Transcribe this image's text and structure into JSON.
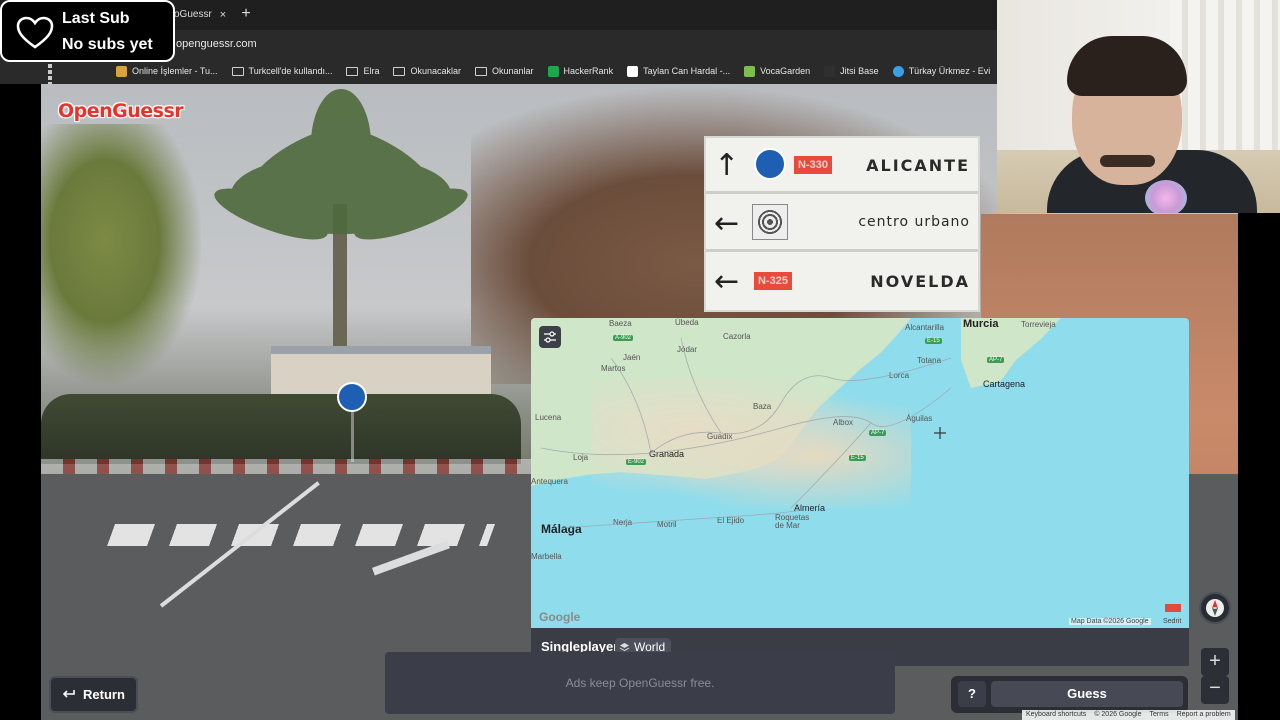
{
  "browser": {
    "tab_title": "oGuessr",
    "tab_close": "×",
    "new_tab": "+",
    "url": "openguessr.com",
    "bookmarks": [
      {
        "label": "Online İşlemler - Tu...",
        "type": "site",
        "color": "#d9a33c"
      },
      {
        "label": "Turkcell'de kullandı...",
        "type": "folder"
      },
      {
        "label": "Elra",
        "type": "folder"
      },
      {
        "label": "Okunacaklar",
        "type": "folder"
      },
      {
        "label": "Okunanlar",
        "type": "folder"
      },
      {
        "label": "HackerRank",
        "type": "site",
        "color": "#1ba94c"
      },
      {
        "label": "Taylan Can Hardal -...",
        "type": "site",
        "color": "#ffffff"
      },
      {
        "label": "VocaGarden",
        "type": "site",
        "color": "#7cc04b"
      },
      {
        "label": "Jitsi Base",
        "type": "site",
        "color": "#2f2f2f"
      },
      {
        "label": "Türkay Ürkmez - Evi",
        "type": "site",
        "color": "#3aa0e6"
      }
    ]
  },
  "sub_badge": {
    "line1": "Last Sub",
    "line2": "No subs yet"
  },
  "game": {
    "logo": "OpenGuessr",
    "road_sign": {
      "rows": [
        {
          "arrow": "↑",
          "plate": "N-330",
          "destination": "ALICANTE"
        },
        {
          "arrow": "←",
          "plate": "",
          "destination": "centro urbano"
        },
        {
          "arrow": "←",
          "plate": "N-325",
          "destination": "NOVELDA"
        }
      ]
    },
    "map": {
      "places": [
        "Baeza",
        "Úbeda",
        "Cazorla",
        "Alcantarilla",
        "Murcia",
        "Torrevieja",
        "Jaén",
        "Jódar",
        "Martos",
        "Lorca",
        "Totana",
        "Cartagena",
        "Baza",
        "Lucena",
        "Guadix",
        "Albox",
        "Águilas",
        "Granada",
        "Loja",
        "Antequera",
        "Almería",
        "Málaga",
        "Nerja",
        "Motril",
        "El Ejido",
        "Roquetas de Mar",
        "Marbella"
      ],
      "roads": [
        "A-902",
        "E-15",
        "AP-7",
        "A-92",
        "E-902",
        "A-7",
        "N11"
      ],
      "google": "Google",
      "attribution": "Map Data ©2026 Google",
      "terms": "Sedrit"
    },
    "mode": "Singleplayer",
    "region": "World",
    "ads_text": "Ads keep OpenGuessr free.",
    "return_label": "Return",
    "help_label": "?",
    "guess_label": "Guess",
    "zoom_in": "+",
    "zoom_out": "−",
    "footer_links": [
      "Keyboard shortcuts",
      "© 2026 Google",
      "Terms",
      "Report a problem"
    ]
  },
  "colors": {
    "logo_red": "#e8322a",
    "panel_dark": "#2c2e36",
    "water": "#8fdcec",
    "land": "#cfe6c9"
  }
}
